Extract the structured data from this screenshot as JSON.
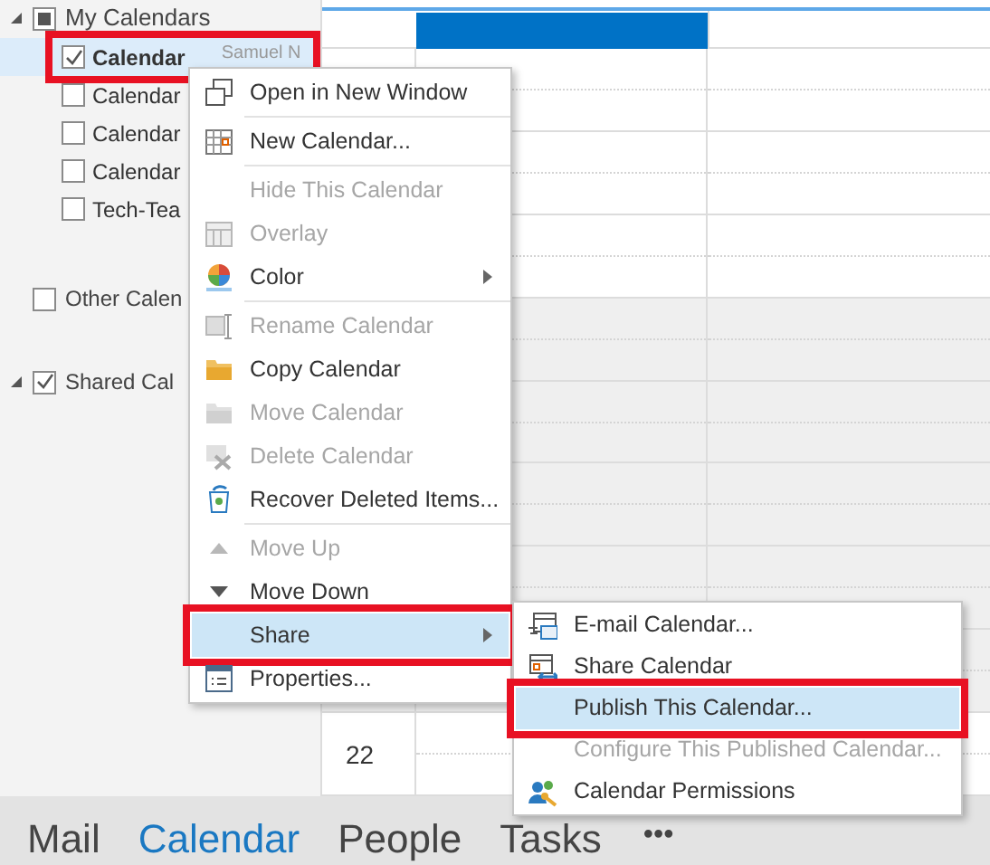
{
  "sidebar": {
    "groups": [
      {
        "label": "My Calendars",
        "indeterminate": true,
        "expanded": true,
        "items": [
          {
            "label": "Calendar",
            "owner": "Samuel N",
            "checked": true,
            "selected": true,
            "highlighted": true
          },
          {
            "label": "Calendar",
            "checked": false,
            "selected": false
          },
          {
            "label": "Calendar",
            "checked": false,
            "selected": false
          },
          {
            "label": "Calendar",
            "checked": false,
            "selected": false
          },
          {
            "label": "Tech-Tea",
            "checked": false,
            "selected": false
          }
        ]
      },
      {
        "label": "Other Calen",
        "checked": false
      },
      {
        "label": "Shared Cal",
        "checked": true,
        "expanded": true
      }
    ]
  },
  "calendar": {
    "date_label": "22"
  },
  "context_menu": [
    {
      "label": "Open in New Window",
      "disabled": false,
      "selected": false
    },
    {
      "label": "New Calendar...",
      "disabled": false,
      "selected": false,
      "separator_before": true
    },
    {
      "label": "Hide This Calendar",
      "disabled": true,
      "selected": false,
      "separator_before": true
    },
    {
      "label": "Overlay",
      "disabled": true,
      "selected": false
    },
    {
      "label": "Color",
      "disabled": false,
      "selected": false,
      "submenu": true
    },
    {
      "label": "Rename Calendar",
      "disabled": true,
      "selected": false,
      "separator_before": true
    },
    {
      "label": "Copy Calendar",
      "disabled": false,
      "selected": false
    },
    {
      "label": "Move Calendar",
      "disabled": true,
      "selected": false
    },
    {
      "label": "Delete Calendar",
      "disabled": true,
      "selected": false
    },
    {
      "label": "Recover Deleted Items...",
      "disabled": false,
      "selected": false
    },
    {
      "label": "Move Up",
      "disabled": true,
      "selected": false,
      "separator_before": true
    },
    {
      "label": "Move Down",
      "disabled": false,
      "selected": false
    },
    {
      "label": "Share",
      "disabled": false,
      "selected": true,
      "submenu": true,
      "highlighted": true
    },
    {
      "label": "Properties...",
      "disabled": false,
      "selected": false
    }
  ],
  "share_submenu": [
    {
      "label": "E-mail Calendar...",
      "disabled": false,
      "selected": false
    },
    {
      "label": "Share Calendar",
      "disabled": false,
      "selected": false
    },
    {
      "label": "Publish This Calendar...",
      "disabled": false,
      "selected": true,
      "highlighted": true
    },
    {
      "label": "Configure This Published Calendar...",
      "disabled": true,
      "selected": false
    },
    {
      "label": "Calendar Permissions",
      "disabled": false,
      "selected": false
    }
  ],
  "nav": [
    {
      "label": "Mail",
      "selected": false
    },
    {
      "label": "Calendar",
      "selected": true
    },
    {
      "label": "People",
      "selected": false
    },
    {
      "label": "Tasks",
      "selected": false
    }
  ],
  "nav_more": {
    "label": "•••"
  }
}
